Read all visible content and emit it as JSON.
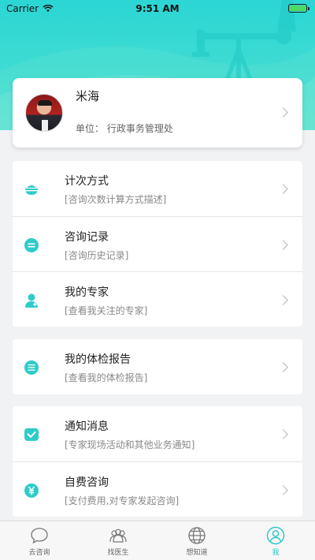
{
  "status_bar": {
    "carrier": "Carrier",
    "time": "9:51 AM"
  },
  "profile": {
    "name": "米海",
    "unit": "单位：  行政事务管理处"
  },
  "menu_groups": [
    [
      {
        "title": "计次方式",
        "desc": "[咨询次数计算方式描述]",
        "icon": "bowl-icon"
      },
      {
        "title": "咨询记录",
        "desc": "[咨询历史记录]",
        "icon": "record-icon"
      },
      {
        "title": "我的专家",
        "desc": "[查看我关注的专家]",
        "icon": "doctor-icon"
      }
    ],
    [
      {
        "title": "我的体检报告",
        "desc": "[查看我的体检报告]",
        "icon": "report-icon"
      }
    ],
    [
      {
        "title": "通知消息",
        "desc": "[专家现场活动和其他业务通知]",
        "icon": "notice-icon"
      },
      {
        "title": "自费咨询",
        "desc": "[支付费用,对专家发起咨询]",
        "icon": "yuan-icon"
      }
    ]
  ],
  "tabs": [
    {
      "label": "去咨询",
      "icon": "chat-bubble-icon"
    },
    {
      "label": "找医生",
      "icon": "doctors-icon"
    },
    {
      "label": "想知道",
      "icon": "globe-icon"
    },
    {
      "label": "我",
      "icon": "user-icon",
      "active": true
    }
  ],
  "colors": {
    "accent": "#27c7c4",
    "header": "#2bd6d4"
  }
}
